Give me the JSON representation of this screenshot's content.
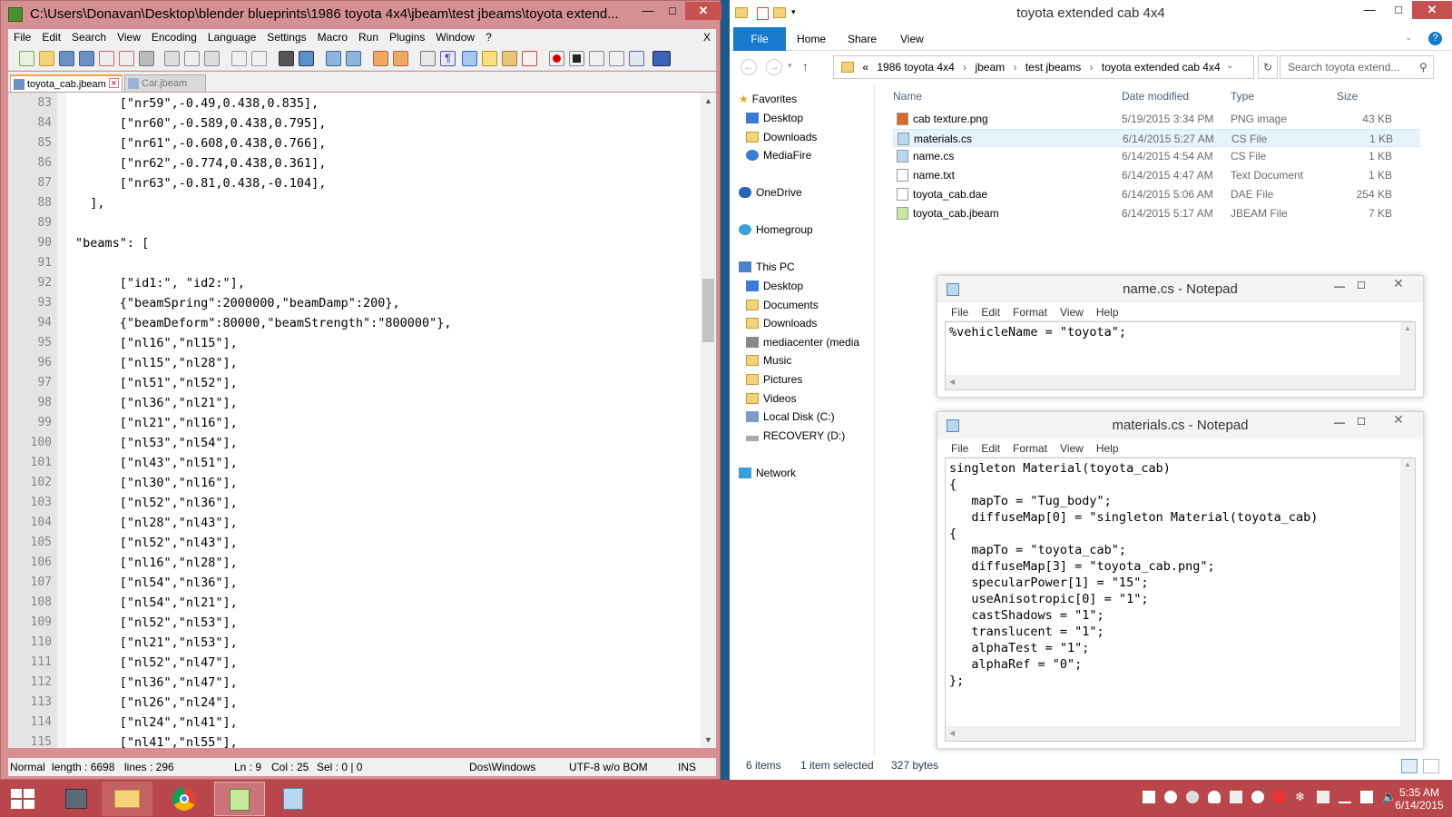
{
  "npp": {
    "title": "C:\\Users\\Donavan\\Desktop\\blender blueprints\\1986 toyota 4x4\\jbeam\\test jbeams\\toyota extend...",
    "menu": [
      "File",
      "Edit",
      "Search",
      "View",
      "Encoding",
      "Language",
      "Settings",
      "Macro",
      "Run",
      "Plugins",
      "Window",
      "?"
    ],
    "menu_close": "X",
    "tabs": [
      "toyota_cab.jbeam",
      "Car.jbeam"
    ],
    "lines": [
      {
        "n": "83",
        "t": "      [\"nr59\",-0.49,0.438,0.835],"
      },
      {
        "n": "84",
        "t": "      [\"nr60\",-0.589,0.438,0.795],"
      },
      {
        "n": "85",
        "t": "      [\"nr61\",-0.608,0.438,0.766],"
      },
      {
        "n": "86",
        "t": "      [\"nr62\",-0.774,0.438,0.361],"
      },
      {
        "n": "87",
        "t": "      [\"nr63\",-0.81,0.438,-0.104],"
      },
      {
        "n": "88",
        "t": "  ],"
      },
      {
        "n": "89",
        "t": ""
      },
      {
        "n": "90",
        "t": "\"beams\": ["
      },
      {
        "n": "91",
        "t": ""
      },
      {
        "n": "92",
        "t": "      [\"id1:\", \"id2:\"],"
      },
      {
        "n": "93",
        "t": "      {\"beamSpring\":2000000,\"beamDamp\":200},"
      },
      {
        "n": "94",
        "t": "      {\"beamDeform\":80000,\"beamStrength\":\"800000\"},"
      },
      {
        "n": "95",
        "t": "      [\"nl16\",\"nl15\"],"
      },
      {
        "n": "96",
        "t": "      [\"nl15\",\"nl28\"],"
      },
      {
        "n": "97",
        "t": "      [\"nl51\",\"nl52\"],"
      },
      {
        "n": "98",
        "t": "      [\"nl36\",\"nl21\"],"
      },
      {
        "n": "99",
        "t": "      [\"nl21\",\"nl16\"],"
      },
      {
        "n": "100",
        "t": "      [\"nl53\",\"nl54\"],"
      },
      {
        "n": "101",
        "t": "      [\"nl43\",\"nl51\"],"
      },
      {
        "n": "102",
        "t": "      [\"nl30\",\"nl16\"],"
      },
      {
        "n": "103",
        "t": "      [\"nl52\",\"nl36\"],"
      },
      {
        "n": "104",
        "t": "      [\"nl28\",\"nl43\"],"
      },
      {
        "n": "105",
        "t": "      [\"nl52\",\"nl43\"],"
      },
      {
        "n": "106",
        "t": "      [\"nl16\",\"nl28\"],"
      },
      {
        "n": "107",
        "t": "      [\"nl54\",\"nl36\"],"
      },
      {
        "n": "108",
        "t": "      [\"nl54\",\"nl21\"],"
      },
      {
        "n": "109",
        "t": "      [\"nl52\",\"nl53\"],"
      },
      {
        "n": "110",
        "t": "      [\"nl21\",\"nl53\"],"
      },
      {
        "n": "111",
        "t": "      [\"nl52\",\"nl47\"],"
      },
      {
        "n": "112",
        "t": "      [\"nl36\",\"nl47\"],"
      },
      {
        "n": "113",
        "t": "      [\"nl26\",\"nl24\"],"
      },
      {
        "n": "114",
        "t": "      [\"nl24\",\"nl41\"],"
      },
      {
        "n": "115",
        "t": "      [\"nl41\",\"nl55\"],"
      }
    ],
    "status": {
      "mode": "Normal",
      "length": "length : 6698",
      "lines": "lines : 296",
      "ln": "Ln : 9",
      "col": "Col : 25",
      "sel": "Sel : 0 | 0",
      "eol": "Dos\\Windows",
      "encoding": "UTF-8 w/o BOM",
      "ins": "INS"
    }
  },
  "explorer": {
    "title": "toyota extended cab 4x4",
    "ribbon": [
      "File",
      "Home",
      "Share",
      "View"
    ],
    "breadcrumb": [
      "«",
      "1986 toyota 4x4",
      "jbeam",
      "test jbeams",
      "toyota extended cab 4x4"
    ],
    "search_placeholder": "Search toyota extend...",
    "nav": {
      "favorites": "Favorites",
      "fav_items": [
        "Desktop",
        "Downloads",
        "MediaFire"
      ],
      "onedrive": "OneDrive",
      "homegroup": "Homegroup",
      "thispc": "This PC",
      "pc_items": [
        "Desktop",
        "Documents",
        "Downloads",
        "mediacenter (media",
        "Music",
        "Pictures",
        "Videos",
        "Local Disk (C:)",
        "RECOVERY (D:)"
      ],
      "network": "Network"
    },
    "columns": [
      "Name",
      "Date modified",
      "Type",
      "Size"
    ],
    "files": [
      {
        "name": "cab texture.png",
        "date": "5/19/2015 3:34 PM",
        "type": "PNG image",
        "size": "43 KB"
      },
      {
        "name": "materials.cs",
        "date": "6/14/2015 5:27 AM",
        "type": "CS File",
        "size": "1 KB"
      },
      {
        "name": "name.cs",
        "date": "6/14/2015 4:54 AM",
        "type": "CS File",
        "size": "1 KB"
      },
      {
        "name": "name.txt",
        "date": "6/14/2015 4:47 AM",
        "type": "Text Document",
        "size": "1 KB"
      },
      {
        "name": "toyota_cab.dae",
        "date": "6/14/2015 5:06 AM",
        "type": "DAE File",
        "size": "254 KB"
      },
      {
        "name": "toyota_cab.jbeam",
        "date": "6/14/2015 5:17 AM",
        "type": "JBEAM File",
        "size": "7 KB"
      }
    ],
    "status": {
      "items": "6 items",
      "selected": "1 item selected",
      "bytes": "327 bytes"
    }
  },
  "notepad_menu": [
    "File",
    "Edit",
    "Format",
    "View",
    "Help"
  ],
  "notepad1": {
    "title": "name.cs - Notepad",
    "text": "%vehicleName = \"toyota\";"
  },
  "notepad2": {
    "title": "materials.cs - Notepad",
    "text": "singleton Material(toyota_cab)\n{\n   mapTo = \"Tug_body\";\n   diffuseMap[0] = \"singleton Material(toyota_cab)\n{\n   mapTo = \"toyota_cab\";\n   diffuseMap[3] = \"toyota_cab.png\";\n   specularPower[1] = \"15\";\n   useAnisotropic[0] = \"1\";\n   castShadows = \"1\";\n   translucent = \"1\";\n   alphaTest = \"1\";\n   alphaRef = \"0\";\n};"
  },
  "clock": {
    "time": "5:35 AM",
    "date": "6/14/2015"
  },
  "colors": {
    "npp_frame": "#d68f93",
    "taskbar": "#b9464b",
    "explorer_accent": "#1979ca"
  }
}
